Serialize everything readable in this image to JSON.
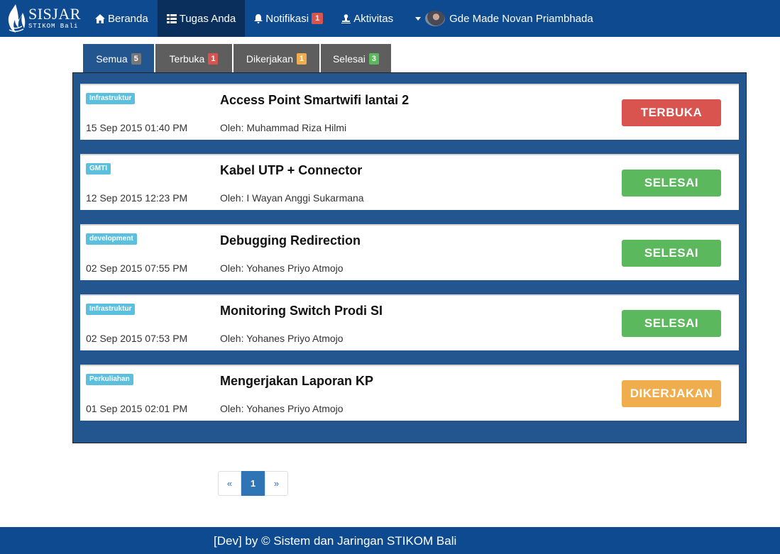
{
  "brand": {
    "title": "SISJAR",
    "subtitle": "STIKOM Bali"
  },
  "nav": {
    "home": "Beranda",
    "tasks": "Tugas Anda",
    "notifications": "Notifikasi",
    "notifications_count": "1",
    "activity": "Aktivitas",
    "user_name": "Gde Made Novan Priambhada"
  },
  "tabs": [
    {
      "label": "Semua",
      "count": "5",
      "badge_color": "#777777",
      "active": true
    },
    {
      "label": "Terbuka",
      "count": "1",
      "badge_color": "#d9534f",
      "active": false
    },
    {
      "label": "Dikerjakan",
      "count": "1",
      "badge_color": "#f0ad4e",
      "active": false
    },
    {
      "label": "Selesai",
      "count": "3",
      "badge_color": "#5cb85c",
      "active": false
    }
  ],
  "tasks": [
    {
      "category": "Infrastruktur",
      "title": "Access Point Smartwifi lantai 2",
      "date": "15 Sep 2015 01:40 PM",
      "author": "Oleh: Muhammad Riza Hilmi",
      "status": "TERBUKA",
      "status_color": "#d9534f"
    },
    {
      "category": "GMTI",
      "title": "Kabel UTP + Connector",
      "date": "12 Sep 2015 12:23 PM",
      "author": "Oleh: I Wayan Anggi Sukarmana",
      "status": "SELESAI",
      "status_color": "#5cb85c"
    },
    {
      "category": "development",
      "title": "Debugging Redirection",
      "date": "02 Sep 2015 07:55 PM",
      "author": "Oleh: Yohanes Priyo Atmojo",
      "status": "SELESAI",
      "status_color": "#5cb85c"
    },
    {
      "category": "Infrastruktur",
      "title": "Monitoring Switch Prodi SI",
      "date": "02 Sep 2015 07:53 PM",
      "author": "Oleh: Yohanes Priyo Atmojo",
      "status": "SELESAI",
      "status_color": "#5cb85c"
    },
    {
      "category": "Perkuliahan",
      "title": "Mengerjakan Laporan KP",
      "date": "01 Sep 2015 02:01 PM",
      "author": "Oleh: Yohanes Priyo Atmojo",
      "status": "DIKERJAKAN",
      "status_color": "#f0ad4e"
    }
  ],
  "pagination": {
    "prev": "«",
    "current": "1",
    "next": "»"
  },
  "footer": {
    "text": "[Dev] by © Sistem dan Jaringan STIKOM Bali"
  }
}
